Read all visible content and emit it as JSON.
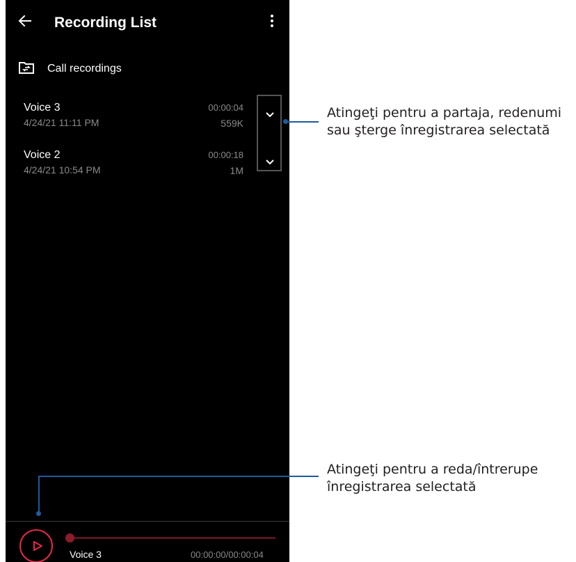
{
  "app": {
    "title": "Recording List",
    "back_icon": "arrow-left-icon",
    "more_icon": "more-vert-icon"
  },
  "folder": {
    "icon": "folder-sync-icon",
    "label": "Call recordings"
  },
  "recordings": [
    {
      "name": "Voice 3",
      "date": "4/24/21 11:11 PM",
      "duration": "00:00:04",
      "size": "559K"
    },
    {
      "name": "Voice 2",
      "date": "4/24/21 10:54 PM",
      "duration": "00:00:18",
      "size": "1M"
    }
  ],
  "player": {
    "icon": "play-icon",
    "track_name": "Voice 3",
    "time": "00:00:00/00:00:04",
    "progress": 0
  },
  "callouts": {
    "options": {
      "line1": "Atingeţi pentru a partaja, redenumi",
      "line2": "sau şterge înregistrarea selectată"
    },
    "play": {
      "line1": "Atingeţi pentru a reda/întrerupe",
      "line2": "înregistrarea selectată"
    }
  },
  "colors": {
    "background": "#000000",
    "accent": "#e8274b",
    "callout_line": "#1e5aa0",
    "secondary_text": "#8a8a8a"
  }
}
